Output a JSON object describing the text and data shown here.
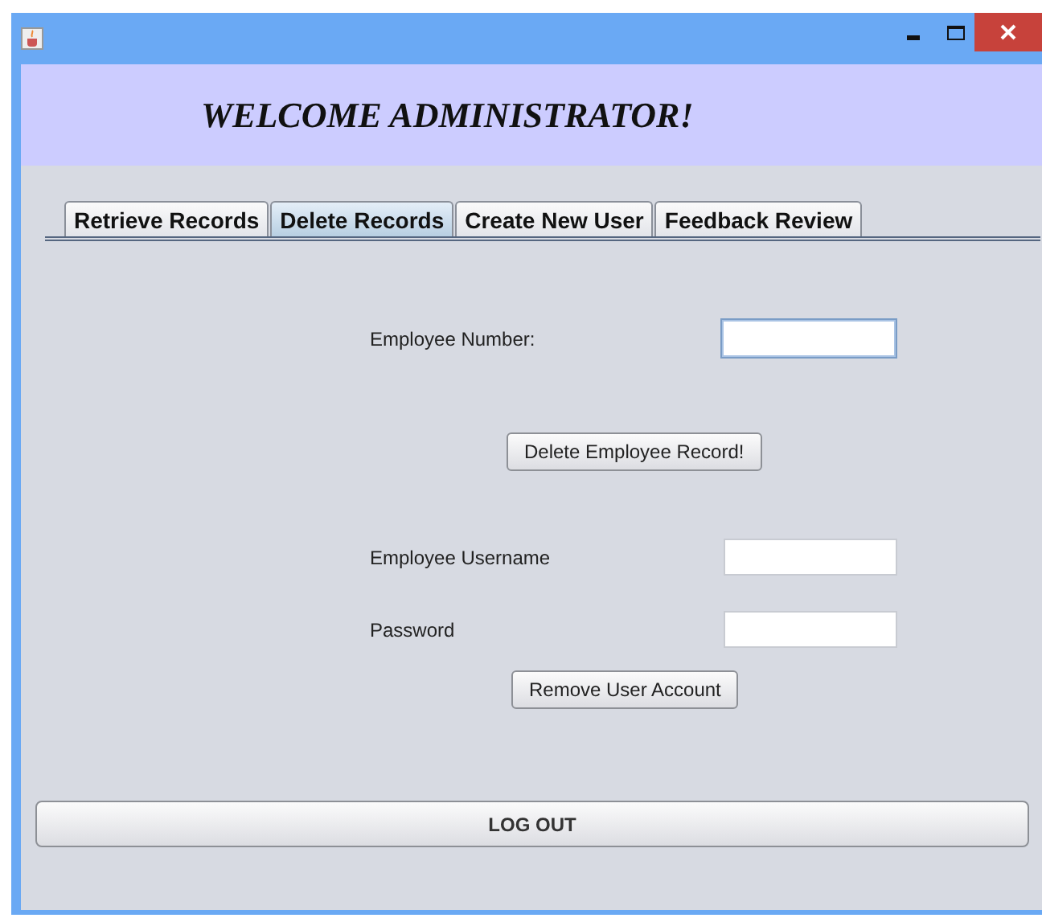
{
  "header": {
    "title": "WELCOME ADMINISTRATOR!"
  },
  "tabs": [
    {
      "label": "Retrieve Records",
      "selected": false
    },
    {
      "label": "Delete Records",
      "selected": true
    },
    {
      "label": "Create New User",
      "selected": false
    },
    {
      "label": "Feedback Review",
      "selected": false
    }
  ],
  "sections": [
    {
      "fields": [
        {
          "label": "Employee Number:",
          "focused": true
        }
      ],
      "button": "Delete Employee Record!"
    },
    {
      "fields": [
        {
          "label": "Employee Username",
          "focused": false
        },
        {
          "label": "Password",
          "focused": false
        }
      ],
      "button": "Remove User Account"
    }
  ],
  "logout_button": "LOG OUT"
}
